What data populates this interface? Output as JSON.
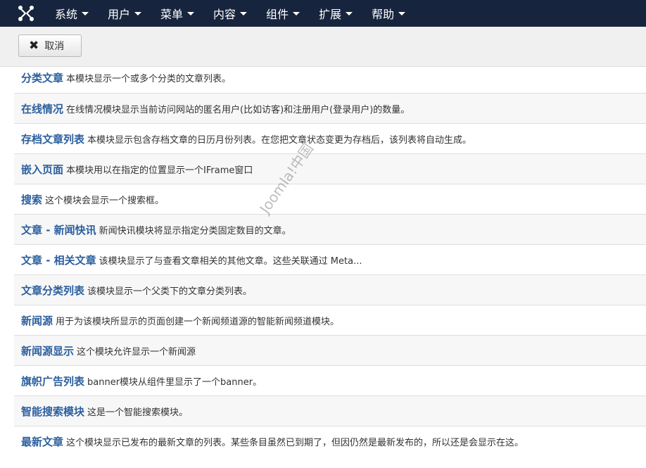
{
  "navbar": {
    "logo_icon": "joomla-logo-icon",
    "menu": [
      {
        "label": "系统"
      },
      {
        "label": "用户"
      },
      {
        "label": "菜单"
      },
      {
        "label": "内容"
      },
      {
        "label": "组件"
      },
      {
        "label": "扩展"
      },
      {
        "label": "帮助"
      }
    ]
  },
  "toolbar": {
    "cancel_label": "取消",
    "cancel_icon": "close-icon"
  },
  "modules": [
    {
      "title": "分类文章",
      "description": "本模块显示一个或多个分类的文章列表。"
    },
    {
      "title": "在线情况",
      "description": "在线情况模块显示当前访问网站的匿名用户(比如访客)和注册用户(登录用户)的数量。"
    },
    {
      "title": "存档文章列表",
      "description": "本模块显示包含存档文章的日历月份列表。在您把文章状态变更为存档后，该列表将自动生成。"
    },
    {
      "title": "嵌入页面",
      "description": "本模块用以在指定的位置显示一个IFrame窗口"
    },
    {
      "title": "搜索",
      "description": "这个模块会显示一个搜索框。"
    },
    {
      "title": "文章 - 新闻快讯",
      "description": "新闻快讯模块将显示指定分类固定数目的文章。"
    },
    {
      "title": "文章 - 相关文章",
      "description": "该模块显示了与查看文章相关的其他文章。这些关联通过 Meta..."
    },
    {
      "title": "文章分类列表",
      "description": "该模块显示一个父类下的文章分类列表。"
    },
    {
      "title": "新闻源",
      "description": "用于为该模块所显示的页面创建一个新闻频道源的智能新闻频道模块。"
    },
    {
      "title": "新闻源显示",
      "description": "这个模块允许显示一个新闻源"
    },
    {
      "title": "旗帜广告列表",
      "description": "banner模块从组件里显示了一个banner。"
    },
    {
      "title": "智能搜索模块",
      "description": "这是一个智能搜索模块。"
    },
    {
      "title": "最新文章",
      "description": "这个模块显示已发布的最新文章的列表。某些条目虽然已到期了，但因仍然是最新发布的，所以还是会显示在这。"
    }
  ],
  "watermark": "Joomla!中国",
  "colors": {
    "navbar_bg": "#17243d",
    "link": "#2b5f9e",
    "alt_row": "#f7f7f7"
  }
}
